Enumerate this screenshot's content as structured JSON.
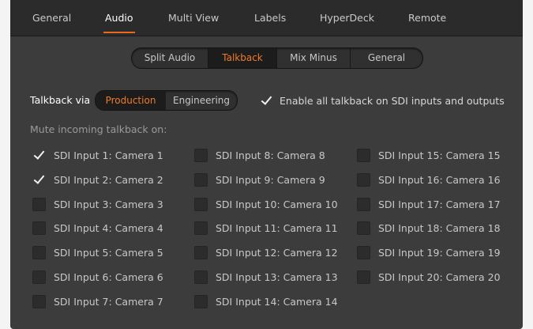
{
  "tabs": [
    {
      "label": "General",
      "active": false
    },
    {
      "label": "Audio",
      "active": true
    },
    {
      "label": "Multi View",
      "active": false
    },
    {
      "label": "Labels",
      "active": false
    },
    {
      "label": "HyperDeck",
      "active": false
    },
    {
      "label": "Remote",
      "active": false
    }
  ],
  "subtabs": [
    {
      "label": "Split Audio",
      "active": false
    },
    {
      "label": "Talkback",
      "active": true
    },
    {
      "label": "Mix Minus",
      "active": false
    },
    {
      "label": "General",
      "active": false
    }
  ],
  "talkback_via": {
    "label": "Talkback via",
    "options": [
      {
        "label": "Production",
        "active": true
      },
      {
        "label": "Engineering",
        "active": false
      }
    ]
  },
  "enable_all": {
    "label": "Enable all talkback on SDI inputs and outputs",
    "checked": true
  },
  "mute_label": "Mute incoming talkback on:",
  "inputs": [
    {
      "label": "SDI Input 1: Camera 1",
      "checked": true
    },
    {
      "label": "SDI Input 2: Camera 2",
      "checked": true
    },
    {
      "label": "SDI Input 3: Camera 3",
      "checked": false
    },
    {
      "label": "SDI Input 4: Camera 4",
      "checked": false
    },
    {
      "label": "SDI Input 5: Camera 5",
      "checked": false
    },
    {
      "label": "SDI Input 6: Camera 6",
      "checked": false
    },
    {
      "label": "SDI Input 7: Camera 7",
      "checked": false
    },
    {
      "label": "SDI Input 8: Camera 8",
      "checked": false
    },
    {
      "label": "SDI Input 9: Camera 9",
      "checked": false
    },
    {
      "label": "SDI Input 10: Camera 10",
      "checked": false
    },
    {
      "label": "SDI Input 11: Camera 11",
      "checked": false
    },
    {
      "label": "SDI Input 12: Camera 12",
      "checked": false
    },
    {
      "label": "SDI Input 13: Camera 13",
      "checked": false
    },
    {
      "label": "SDI Input 14: Camera 14",
      "checked": false
    },
    {
      "label": "SDI Input 15: Camera 15",
      "checked": false
    },
    {
      "label": "SDI Input 16: Camera 16",
      "checked": false
    },
    {
      "label": "SDI Input 17: Camera 17",
      "checked": false
    },
    {
      "label": "SDI Input 18: Camera 18",
      "checked": false
    },
    {
      "label": "SDI Input 19: Camera 19",
      "checked": false
    },
    {
      "label": "SDI Input 20: Camera 20",
      "checked": false
    }
  ],
  "colors": {
    "accent": "#f07a2a",
    "panel": "#3c3c3c",
    "tabbar": "#2b2b2b"
  }
}
